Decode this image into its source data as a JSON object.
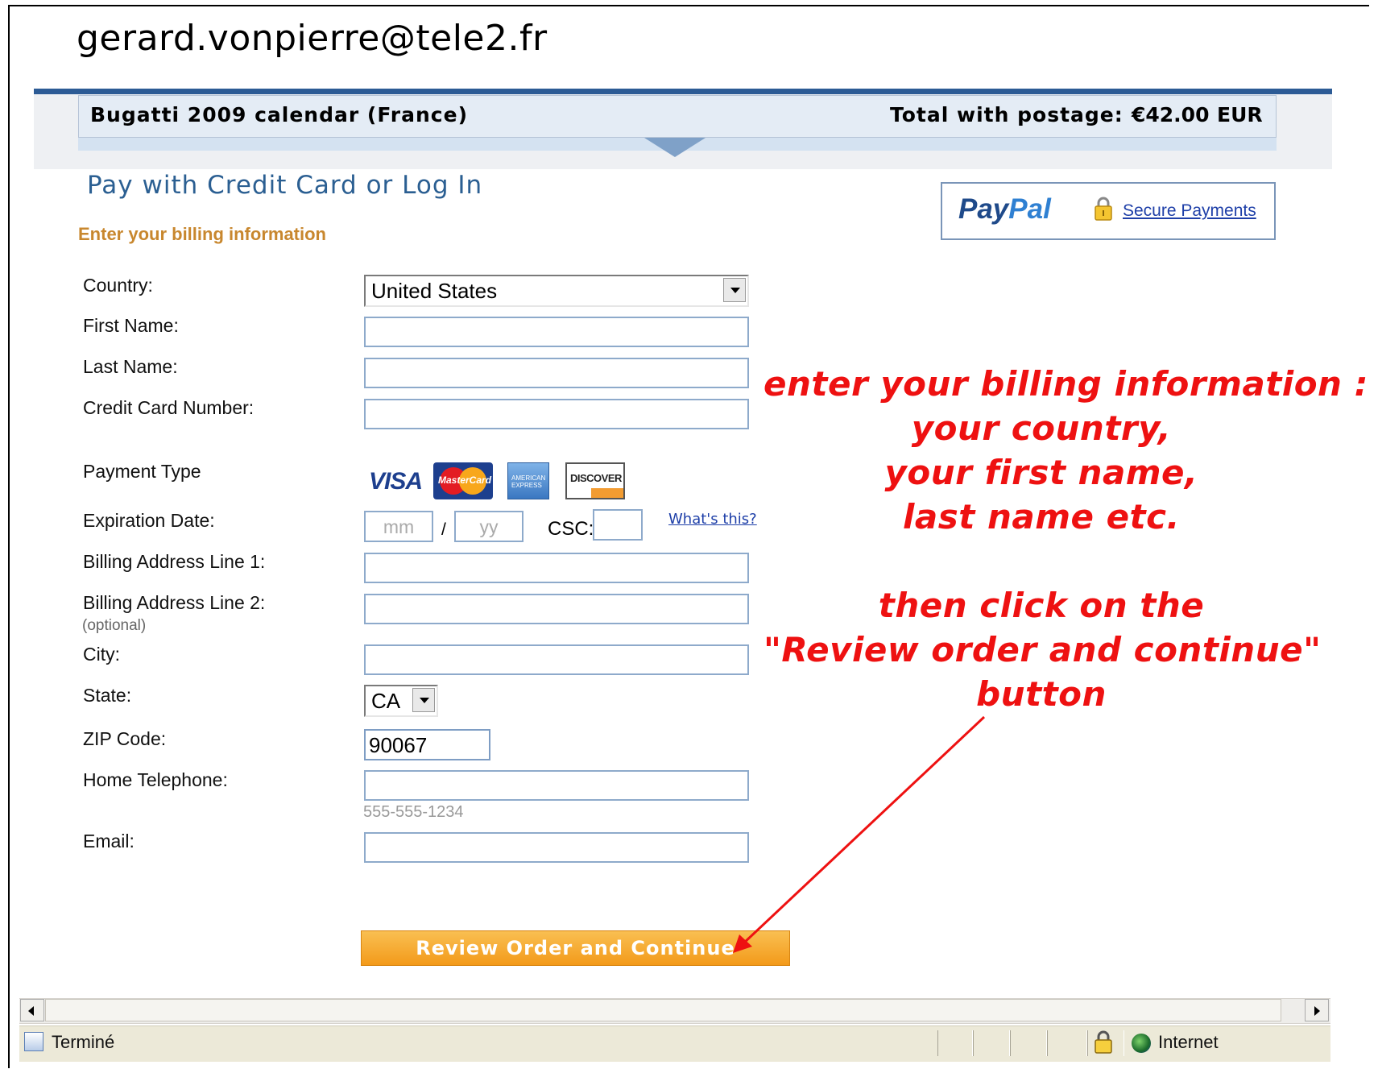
{
  "header": {
    "account_email": "gerard.vonpierre@tele2.fr"
  },
  "order_summary": {
    "item_name": "Bugatti 2009 calendar (France)",
    "total_label": "Total with postage:",
    "total_amount": "€42.00",
    "currency": "EUR"
  },
  "page": {
    "heading": "Pay with Credit Card or Log In",
    "subheading": "Enter your billing information"
  },
  "paypal": {
    "logo_pay": "Pay",
    "logo_pal": "Pal",
    "secure_link": "Secure Payments"
  },
  "form": {
    "country": {
      "label": "Country:",
      "value": "United States"
    },
    "first_name": {
      "label": "First Name:",
      "value": ""
    },
    "last_name": {
      "label": "Last Name:",
      "value": ""
    },
    "card_number": {
      "label": "Credit Card Number:",
      "value": ""
    },
    "payment_type": {
      "label": "Payment Type",
      "cards": {
        "visa": "VISA",
        "mastercard": "MasterCard",
        "amex": "AMERICAN EXPRESS",
        "discover": "DISCOVER"
      }
    },
    "expiration": {
      "label": "Expiration Date:",
      "month_placeholder": "mm",
      "separator": "/",
      "year_placeholder": "yy"
    },
    "csc": {
      "label": "CSC:",
      "help_link": "What's this?"
    },
    "address1": {
      "label": "Billing Address Line 1:",
      "value": ""
    },
    "address2": {
      "label": "Billing Address Line 2:",
      "note": "(optional)",
      "value": ""
    },
    "city": {
      "label": "City:",
      "value": ""
    },
    "state": {
      "label": "State:",
      "value": "CA"
    },
    "zip": {
      "label": "ZIP Code:",
      "value": "90067"
    },
    "phone": {
      "label": "Home Telephone:",
      "hint": "555-555-1234",
      "value": ""
    },
    "email": {
      "label": "Email:",
      "value": ""
    },
    "submit_label": "Review Order and Continue"
  },
  "annotation": {
    "lines": [
      "enter your billing information :",
      "your country,",
      "your first name,",
      "last name etc.",
      "then click on the",
      "\"Review order and continue\"",
      "button"
    ]
  },
  "status_bar": {
    "status": "Terminé",
    "zone": "Internet"
  },
  "colors": {
    "annotation_red": "#ee1111",
    "heading_blue": "#2b5f92",
    "subheading_orange": "#c8872e",
    "button_orange": "#f5a52a"
  }
}
